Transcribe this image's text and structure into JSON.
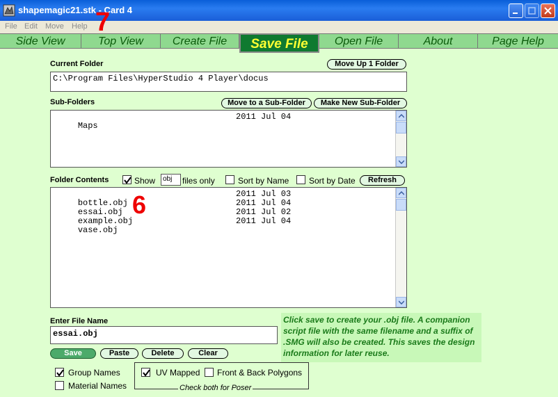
{
  "window": {
    "title": "shapemagic21.stk - Card 4"
  },
  "menu": [
    "File",
    "Edit",
    "Move",
    "Help"
  ],
  "tabs": [
    {
      "label": "Side View",
      "active": false
    },
    {
      "label": "Top View",
      "active": false
    },
    {
      "label": "Create File",
      "active": false
    },
    {
      "label": "Save File",
      "active": true
    },
    {
      "label": "Open File",
      "active": false
    },
    {
      "label": "About",
      "active": false
    },
    {
      "label": "Page Help",
      "active": false
    }
  ],
  "current_folder": {
    "label": "Current Folder",
    "path": "C:\\Program Files\\HyperStudio 4 Player\\docus",
    "move_up_label": "Move Up 1 Folder"
  },
  "sub_folders": {
    "label": "Sub-Folders",
    "move_to_label": "Move to a Sub-Folder",
    "make_new_label": "Make New Sub-Folder",
    "items": [
      {
        "name": "Maps",
        "date": "2011 Jul 04"
      }
    ]
  },
  "folder_contents": {
    "label": "Folder Contents",
    "show_label": "Show",
    "show_checked": true,
    "filter_ext": "obj",
    "files_only_label": "files only",
    "sort_name_label": "Sort by Name",
    "sort_date_label": "Sort by Date",
    "refresh_label": "Refresh",
    "items": [
      {
        "name": "bottle.obj",
        "date": "2011 Jul 03"
      },
      {
        "name": "essai.obj",
        "date": "2011 Jul 04"
      },
      {
        "name": "example.obj",
        "date": "2011 Jul 02"
      },
      {
        "name": "vase.obj",
        "date": "2011 Jul 04"
      }
    ]
  },
  "annotations": {
    "seven": "7",
    "six": "6"
  },
  "file_name": {
    "label": "Enter File Name",
    "value": "essai.obj"
  },
  "actions": {
    "save": "Save",
    "paste": "Paste",
    "delete": "Delete",
    "clear": "Clear"
  },
  "help_text": "Click save to create your .obj file. A companion script file with the same filename and a suffix of .SMG will also be created. This saves the design information for later reuse.",
  "options": {
    "group_names": {
      "label": "Group Names",
      "checked": true
    },
    "material_names": {
      "label": "Material  Names",
      "checked": false
    },
    "uv_mapped": {
      "label": "UV Mapped",
      "checked": true
    },
    "front_back": {
      "label": "Front & Back  Polygons",
      "checked": false
    },
    "poser_hint": "Check both for Poser"
  },
  "colors": {
    "background": "#dfffd0",
    "tab_bar": "#8fd98f",
    "active_tab": "#0f7a30",
    "active_tab_text": "#ffff33",
    "help_text": "#1a7a1a",
    "annotation": "#ee0000"
  }
}
